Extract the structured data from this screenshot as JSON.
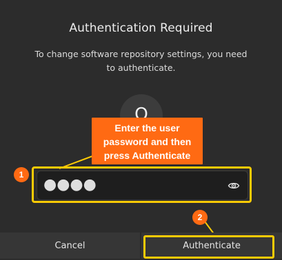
{
  "dialog": {
    "title": "Authentication Required",
    "message_line1": "To change software repository settings, you need",
    "message_line2": "to authenticate.",
    "avatar_letter": "O"
  },
  "password": {
    "masked_value": "●●●●",
    "reveal_icon": "eye-icon"
  },
  "annotation": {
    "callout_line1": "Enter the user",
    "callout_line2": "password and then",
    "callout_line3": "press Authenticate",
    "badge1": "1",
    "badge2": "2",
    "accent_color": "#ff6a13",
    "highlight_color": "#ffcb05"
  },
  "buttons": {
    "cancel_label": "Cancel",
    "authenticate_label": "Authenticate"
  }
}
